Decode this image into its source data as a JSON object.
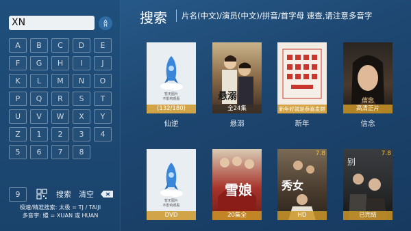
{
  "search": {
    "query": "XN",
    "voice_icon": "rocket-icon"
  },
  "keyboard": {
    "keys": [
      "A",
      "B",
      "C",
      "D",
      "E",
      "F",
      "G",
      "H",
      "I",
      "J",
      "K",
      "L",
      "M",
      "N",
      "O",
      "P",
      "Q",
      "R",
      "S",
      "T",
      "U",
      "V",
      "W",
      "X",
      "Y",
      "Z",
      "1",
      "2",
      "3",
      "4",
      "5",
      "6",
      "7",
      "8"
    ],
    "key_9": "9",
    "grid_icon": "qr-grid-icon",
    "search_label": "搜索",
    "clear_label": "清空",
    "delete_icon": "backspace-icon"
  },
  "hints": {
    "line1": "极速/精准搜索: 太极 = TJ / TAIJI",
    "line2": "多音字: 嬛 = XUAN 或 HUAN"
  },
  "header": {
    "title": "搜索",
    "tip": "片名(中文)/演员(中文)/拼音/首字母 速查,请注意多音字"
  },
  "results": [
    {
      "title": "仙逆",
      "badge": "(132/180)",
      "poster_text": "暂无图片\n不影响观看"
    },
    {
      "title": "悬溺",
      "badge": "全24集",
      "poster_text": "悬溺"
    },
    {
      "title": "新年",
      "badge": "新年好就是恭喜发财",
      "poster_text": ""
    },
    {
      "title": "信念",
      "badge": "高清正片",
      "poster_text": "信念"
    },
    {
      "title": "",
      "badge": "DVD",
      "poster_text": "暂无图片\n不影响观看"
    },
    {
      "title": "",
      "badge": "20集全",
      "poster_text": "雪娘"
    },
    {
      "title": "",
      "badge": "HD",
      "rating": "7.8",
      "poster_text": "秀女"
    },
    {
      "title": "",
      "badge": "已完结",
      "rating": "7.8",
      "poster_text": "别"
    }
  ],
  "colors": {
    "background": "#1d4670",
    "badge": "#cd9628"
  }
}
